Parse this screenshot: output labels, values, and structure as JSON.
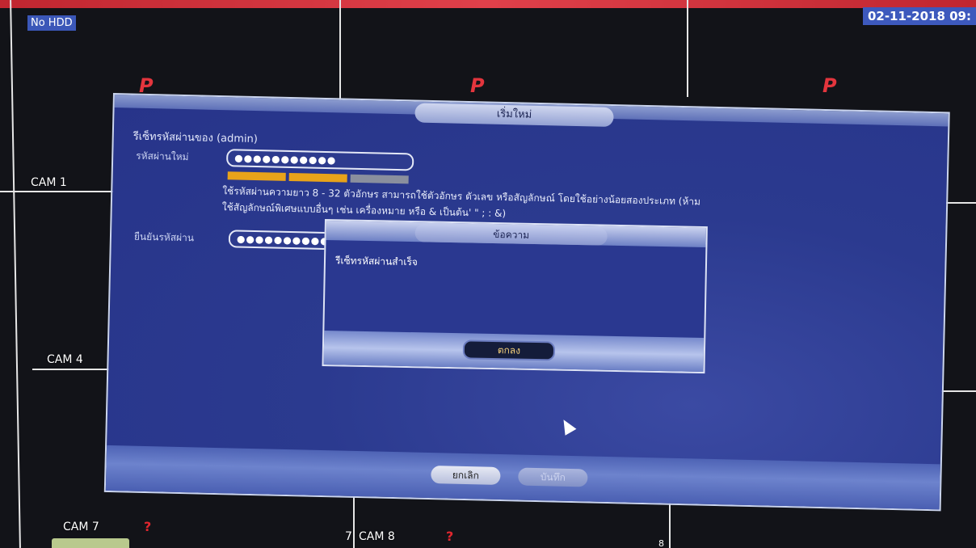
{
  "status": {
    "hdd": "No HDD",
    "datetime": "02-11-2018 09:"
  },
  "cameras": {
    "cam1": "CAM 1",
    "cam4": "CAM 4",
    "cam7": "CAM 7",
    "cam8": "CAM 8",
    "num7": "7",
    "num8": "8"
  },
  "dialog": {
    "title": "เริ่มใหม่",
    "subtitle": "รีเซ็ทรหัสผ่านของ (admin)",
    "new_password_label": "รหัสผ่านใหม่",
    "new_password_value": "●●●●●●●●●●●",
    "confirm_password_label": "ยืนยันรหัสผ่าน",
    "confirm_password_value": "●●●●●●●●●●",
    "hint_line1": "ใช้รหัสผ่านความยาว 8 - 32 ตัวอักษร สามารถใช้ตัวอักษร ตัวเลข หรือสัญลักษณ์ โดยใช้อย่างน้อยสองประเภท (ห้าม",
    "hint_line2": "ใช้สัญลักษณ์พิเศษแบบอื่นๆ เช่น เครื่องหมาย  หรือ & เป็นต้น' \" ; : &)",
    "cancel_label": "ยกเลิก",
    "save_label": "บันทึก"
  },
  "message": {
    "title": "ข้อความ",
    "text": "รีเซ็ทรหัสผ่านสำเร็จ",
    "ok_label": "ตกลง"
  },
  "colors": {
    "accent": "#2c3a8e",
    "strength_strong": "#e8a31a",
    "strength_weak": "#8a8f9e"
  }
}
